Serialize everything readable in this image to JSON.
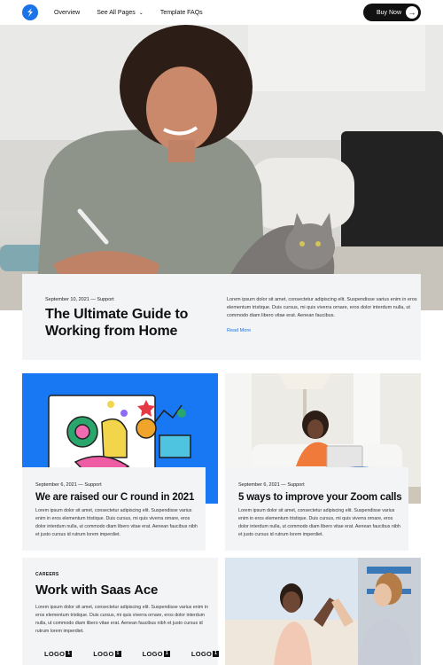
{
  "header": {
    "nav": [
      {
        "label": "Overview"
      },
      {
        "label": "See All Pages"
      },
      {
        "label": "Template FAQs"
      }
    ],
    "buy_label": "Buy Now",
    "buy_icon": "arrow-right-icon"
  },
  "feature": {
    "meta": "September 10, 2021 — Support",
    "title": "The Ultimate Guide to Working from Home",
    "description": "Lorem ipsum dolor sit amet, consectetur adipiscing elit. Suspendisse varius enim in eros elementum tristique. Duis cursus, mi quis viverra ornare, eros dolor interdum nulla, ut commodo diam libero vitae erat. Aenean faucibus.",
    "read_more": "Read More"
  },
  "cards": [
    {
      "meta": "September 6, 2021 — Support",
      "title": "We are raised our C round in 2021",
      "description": "Lorem ipsum dolor sit amet, consectetur adipiscing elit. Suspendisse varius enim in eros elementum tristique. Duis cursus, mi quis viverra ornare, eros dolor interdum nulla, ut commodo diam libero vitae erat. Aenean faucibus nibh et justo cursus id rutrum lorem imperdiet."
    },
    {
      "meta": "September 6, 2021 — Support",
      "title": "5 ways to improve your Zoom calls",
      "description": "Lorem ipsum dolor sit amet, consectetur adipiscing elit. Suspendisse varius enim in eros elementum tristique. Duis cursus, mi quis viverra ornare, eros dolor interdum nulla, ut commodo diam libero vitae erat. Aenean faucibus nibh et justo cursus id rutrum lorem imperdiet."
    }
  ],
  "careers": {
    "tag": "CAREERS",
    "title": "Work with Saas Ace",
    "description": "Lorem ipsum dolor sit amet, consectetur adipiscing elit. Suspendisse varius enim in eros elementum tristique. Duis cursus, mi quis viverra ornare, eros dolor interdum nulla, ut commodo diam libero vitae erat. Aenean faucibus nibh et justo cursus id rutrum lorem imperdiet.",
    "logos": [
      {
        "label": "LOGO",
        "mark": "1"
      },
      {
        "label": "LOGO",
        "mark": "1"
      },
      {
        "label": "LOGO",
        "mark": "1"
      },
      {
        "label": "LOGO",
        "mark": "1"
      }
    ]
  },
  "colors": {
    "brand_blue": "#1a73e8",
    "card_bg": "#f3f4f6",
    "button_dark": "#111111"
  }
}
